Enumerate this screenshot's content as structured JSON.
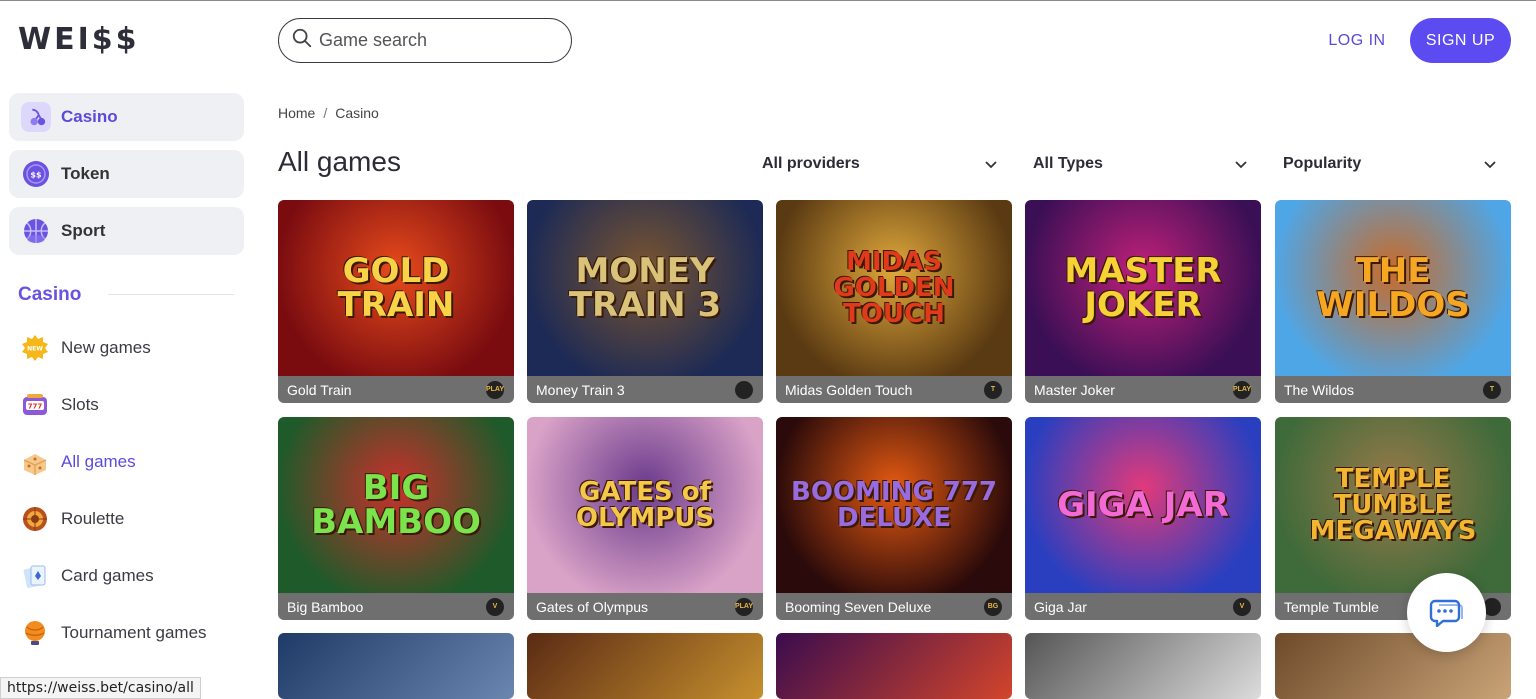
{
  "header": {
    "logo": "WEI$$",
    "search_placeholder": "Game search",
    "login_label": "LOG IN",
    "signup_label": "SIGN UP"
  },
  "sidebar": {
    "tiles": [
      {
        "label": "Casino",
        "icon": "cherries-icon",
        "active": true
      },
      {
        "label": "Token",
        "icon": "token-coin-icon",
        "active": false
      },
      {
        "label": "Sport",
        "icon": "basketball-icon",
        "active": false
      }
    ],
    "section_title": "Casino",
    "items": [
      {
        "label": "New games",
        "icon": "new-badge-icon"
      },
      {
        "label": "Slots",
        "icon": "slot-machine-icon"
      },
      {
        "label": "All games",
        "icon": "dice-icon",
        "active": true
      },
      {
        "label": "Roulette",
        "icon": "roulette-icon"
      },
      {
        "label": "Card games",
        "icon": "playing-cards-icon"
      },
      {
        "label": "Tournament games",
        "icon": "trophy-icon"
      }
    ]
  },
  "breadcrumb": {
    "home": "Home",
    "separator": "/",
    "current": "Casino"
  },
  "main": {
    "title": "All games",
    "filters": {
      "providers": "All providers",
      "types": "All Types",
      "sort": "Popularity"
    }
  },
  "games": [
    {
      "name": "Gold Train",
      "art_text": "GOLD TRAIN",
      "provider_badge": "PLAY",
      "bg1": "#7a0c10",
      "bg2": "#e84b1c",
      "fg": "#f8d347"
    },
    {
      "name": "Money Train 3",
      "art_text": "MONEY TRAIN 3",
      "provider_badge": "",
      "bg1": "#1d2a55",
      "bg2": "#7a5530",
      "fg": "#d9c27a"
    },
    {
      "name": "Midas Golden Touch",
      "art_text": "MIDAS GOLDEN TOUCH",
      "provider_badge": "T",
      "bg1": "#5a3a12",
      "bg2": "#e0a83b",
      "fg": "#e03a1a"
    },
    {
      "name": "Master Joker",
      "art_text": "MASTER JOKER",
      "provider_badge": "PLAY",
      "bg1": "#3a0f55",
      "bg2": "#c0207a",
      "fg": "#f6d236"
    },
    {
      "name": "The Wildos",
      "art_text": "THE WILDOS",
      "provider_badge": "T",
      "bg1": "#4fa6e6",
      "bg2": "#c76b2a",
      "fg": "#f5a623"
    },
    {
      "name": "Big Bamboo",
      "art_text": "BIG BAMBOO",
      "provider_badge": "V",
      "bg1": "#1f5a2a",
      "bg2": "#c9302b",
      "fg": "#7be34b"
    },
    {
      "name": "Gates of Olympus",
      "art_text": "GATES of OLYMPUS",
      "provider_badge": "PLAY",
      "bg1": "#d9a2c7",
      "bg2": "#6a3a8c",
      "fg": "#f5c84a"
    },
    {
      "name": "Booming Seven Deluxe",
      "art_text": "BOOMING 777 DELUXE",
      "provider_badge": "BG",
      "bg1": "#2a0a0a",
      "bg2": "#e55a12",
      "fg": "#9a6adf"
    },
    {
      "name": "Giga Jar",
      "art_text": "GIGA JAR",
      "provider_badge": "V",
      "bg1": "#2a3fbf",
      "bg2": "#e23a7a",
      "fg": "#f36ad7"
    },
    {
      "name": "Temple Tumble",
      "art_text": "TEMPLE TUMBLE MEGAWAYS",
      "provider_badge": "",
      "bg1": "#3f6a3a",
      "bg2": "#9a7a4a",
      "fg": "#f2b632"
    }
  ],
  "partial_row_colors": [
    {
      "bg1": "#1f3a66",
      "bg2": "#6b87b0"
    },
    {
      "bg1": "#5a2a14",
      "bg2": "#c6902e"
    },
    {
      "bg1": "#3a0c4e",
      "bg2": "#d2452b"
    },
    {
      "bg1": "#555555",
      "bg2": "#dcdcdc"
    },
    {
      "bg1": "#6e4a2a",
      "bg2": "#c9a478"
    }
  ],
  "status_url": "https://weiss.bet/casino/all"
}
